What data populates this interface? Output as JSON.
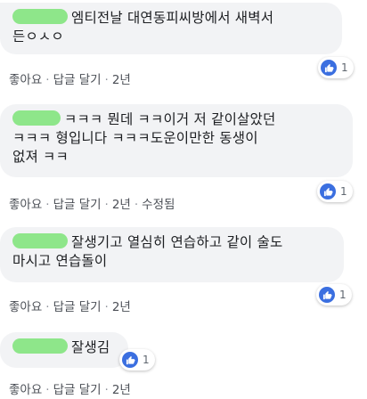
{
  "comments": [
    {
      "lines": [
        "엠티전날 대연동피씨방에서 새벽서",
        "든ㅇㅅㅇ"
      ],
      "like_count": "1",
      "actions": [
        "좋아요",
        "답글 달기",
        "2년"
      ]
    },
    {
      "lines": [
        "ㅋㅋㅋ 뭔데 ㅋㅋ이거 저 같이살았던",
        "ㅋㅋㅋ 형입니다 ㅋㅋㅋ도운이만한 동생이",
        "없져 ㅋㅋ"
      ],
      "like_count": "1",
      "actions": [
        "좋아요",
        "답글 달기",
        "2년",
        "수정됨"
      ]
    },
    {
      "lines": [
        "잘생기고 열심히 연습하고 같이 술도",
        "마시고 연습돌이"
      ],
      "like_count": "1",
      "actions": [
        "좋아요",
        "답글 달기",
        "2년"
      ]
    },
    {
      "lines": [
        "잘생김"
      ],
      "like_count": "1",
      "actions": [
        "좋아요",
        "답글 달기",
        "2년"
      ]
    }
  ],
  "colors": {
    "bubble": "#f2f3f5",
    "redaction": "#8ee68a",
    "like_icon": "#3b6fe0"
  },
  "icons": {
    "like": "thumbs-up-icon"
  }
}
